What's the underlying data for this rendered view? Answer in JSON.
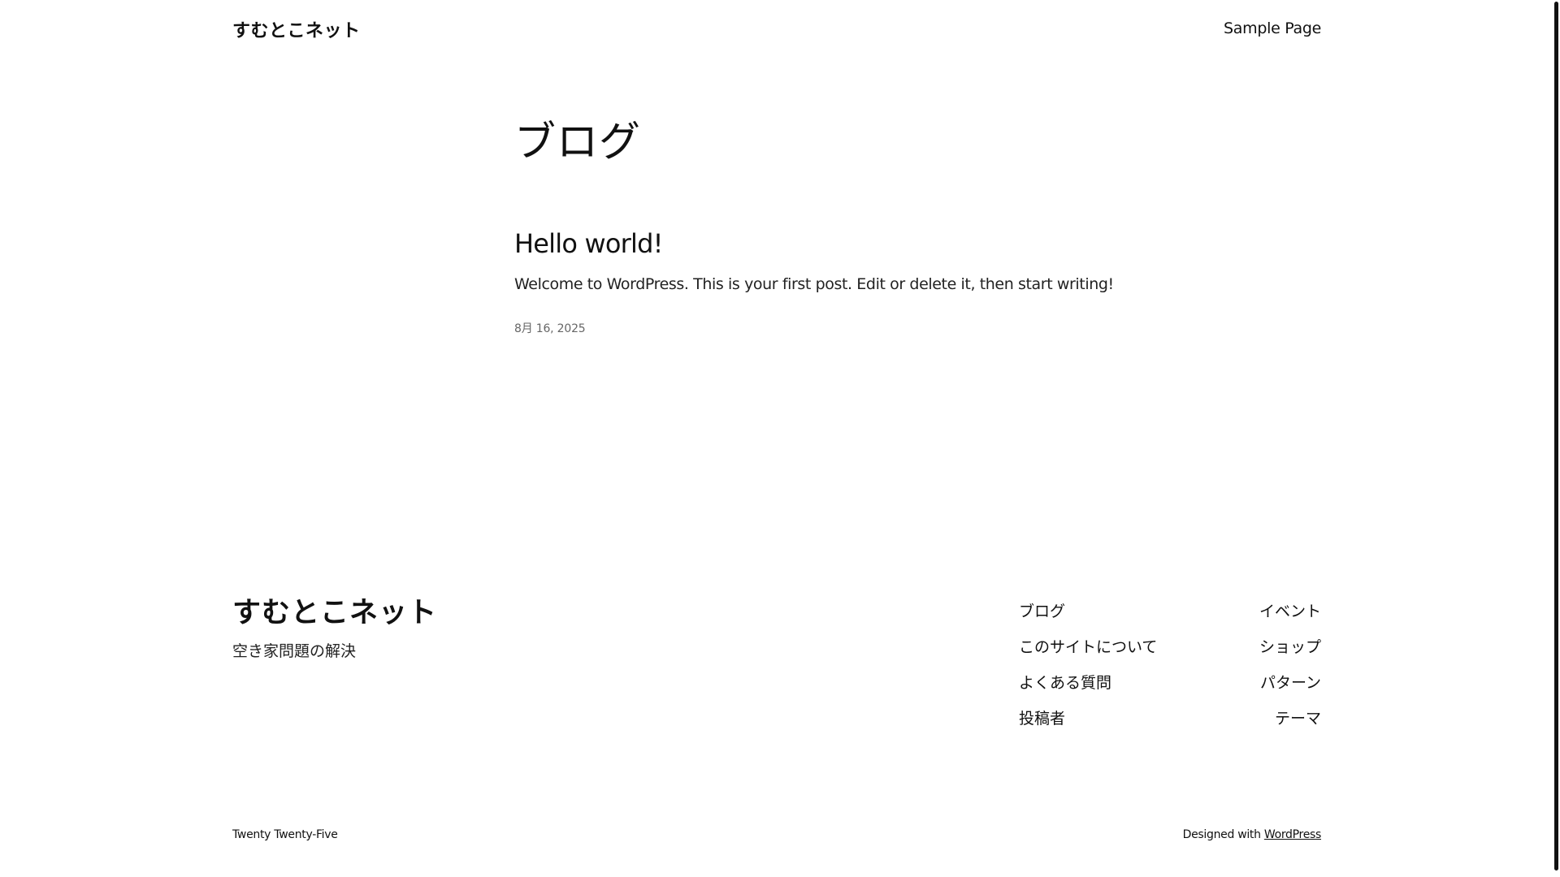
{
  "header": {
    "site_title": "すむとこネット",
    "nav_items": [
      "Sample Page"
    ]
  },
  "main": {
    "page_heading": "ブログ",
    "posts": [
      {
        "title": "Hello world!",
        "excerpt": "Welcome to WordPress. This is your first post. Edit or delete it, then start writing!",
        "date": "8月 16, 2025"
      }
    ]
  },
  "footer": {
    "site_title": "すむとこネット",
    "tagline": "空き家問題の解決",
    "nav_col1": [
      "ブログ",
      "このサイトについて",
      "よくある質問",
      "投稿者"
    ],
    "nav_col2": [
      "イベント",
      "ショップ",
      "パターン",
      "テーマ"
    ],
    "theme_name": "Twenty Twenty-Five",
    "credit_prefix": "Designed with",
    "credit_link": "WordPress"
  }
}
